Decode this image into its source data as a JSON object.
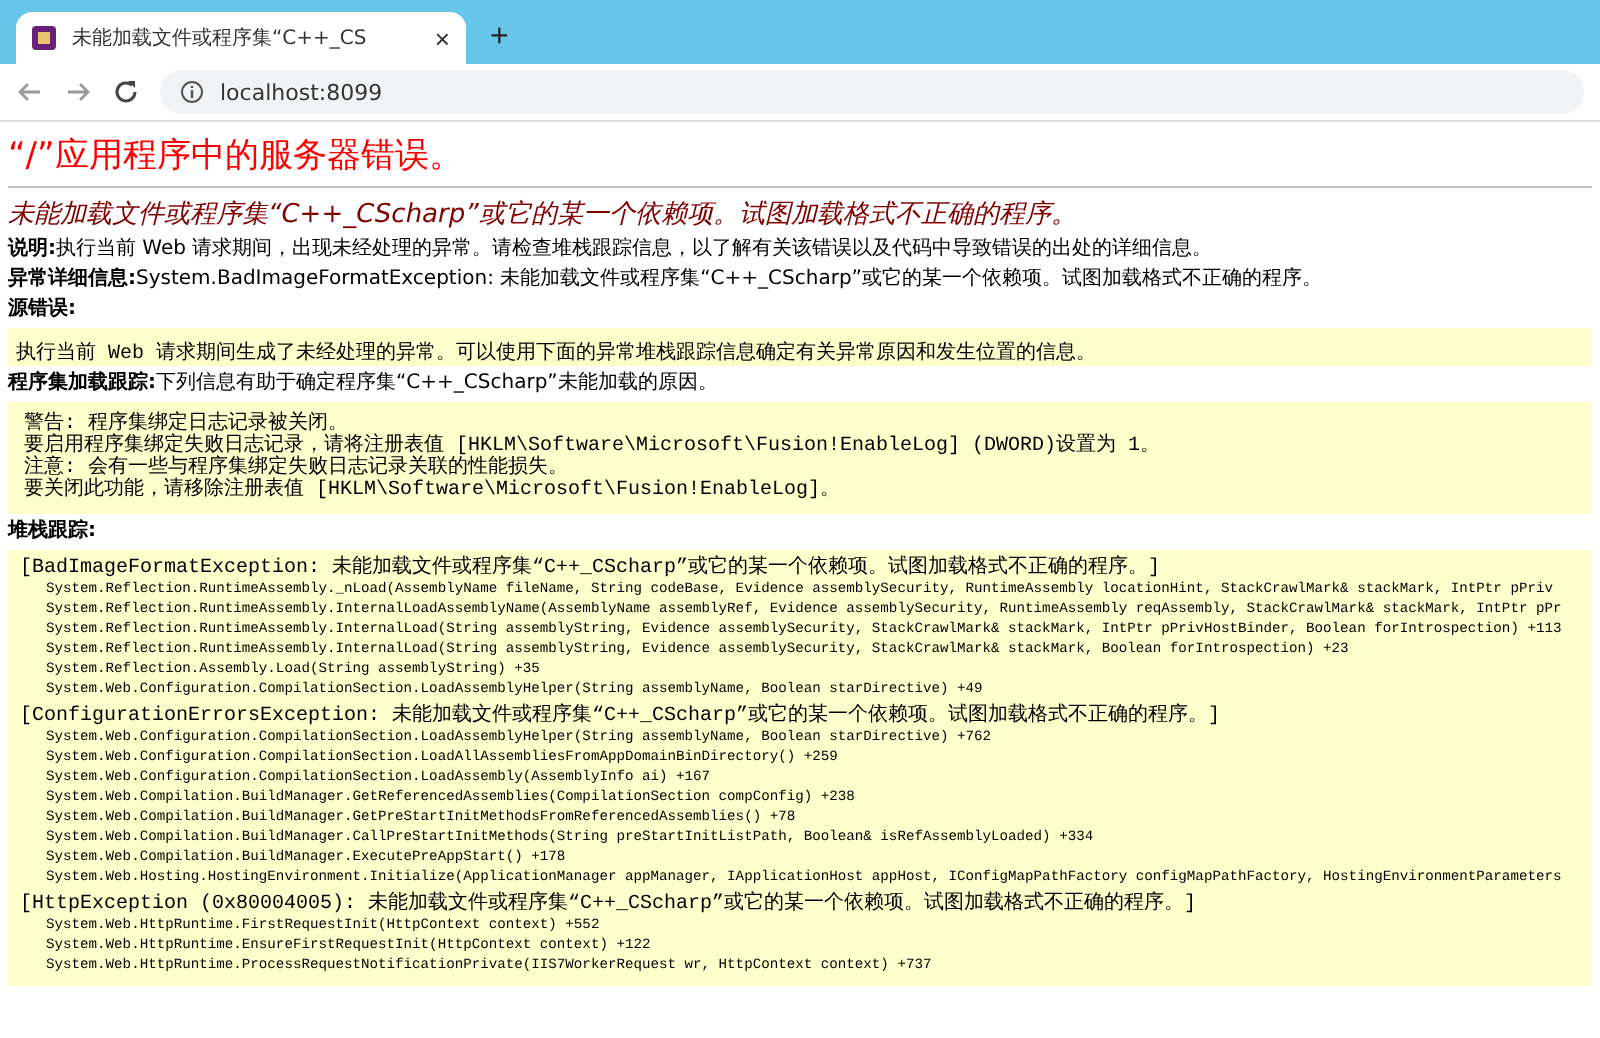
{
  "browser": {
    "tab_title": "未能加载文件或程序集“C++_CS",
    "tab_close": "×",
    "new_tab": "+",
    "url": "localhost:8099"
  },
  "page": {
    "heading": "“/”应用程序中的服务器错误。",
    "subheading": "未能加载文件或程序集“C++_CScharp”或它的某一个依赖项。试图加载格式不正确的程序。",
    "description": {
      "label": "说明:",
      "text": "执行当前 Web 请求期间，出现未经处理的异常。请检查堆栈跟踪信息，以了解有关该错误以及代码中导致错误的出处的详细信息。"
    },
    "exception_details": {
      "label": "异常详细信息:",
      "text": "System.BadImageFormatException: 未能加载文件或程序集“C++_CScharp”或它的某一个依赖项。试图加载格式不正确的程序。"
    },
    "source_error": {
      "label": "源错误:",
      "text": "执行当前 Web 请求期间生成了未经处理的异常。可以使用下面的异常堆栈跟踪信息确定有关异常原因和发生位置的信息。"
    },
    "assembly_trace": {
      "label": "程序集加载跟踪:",
      "text": "下列信息有助于确定程序集“C++_CScharp”未能加载的原因。",
      "lines": [
        "警告: 程序集绑定日志记录被关闭。",
        "要启用程序集绑定失败日志记录，请将注册表值 [HKLM\\Software\\Microsoft\\Fusion!EnableLog] (DWORD)设置为 1。",
        "注意: 会有一些与程序集绑定失败日志记录关联的性能损失。",
        "要关闭此功能，请移除注册表值 [HKLM\\Software\\Microsoft\\Fusion!EnableLog]。"
      ]
    },
    "stack_trace": {
      "label": "堆栈跟踪:",
      "blocks": [
        {
          "header": "[BadImageFormatException: 未能加载文件或程序集“C++_CScharp”或它的某一个依赖项。试图加载格式不正确的程序。]",
          "lines": [
            "System.Reflection.RuntimeAssembly._nLoad(AssemblyName fileName, String codeBase, Evidence assemblySecurity, RuntimeAssembly locationHint, StackCrawlMark& stackMark, IntPtr pPriv",
            "System.Reflection.RuntimeAssembly.InternalLoadAssemblyName(AssemblyName assemblyRef, Evidence assemblySecurity, RuntimeAssembly reqAssembly, StackCrawlMark& stackMark, IntPtr pPr",
            "System.Reflection.RuntimeAssembly.InternalLoad(String assemblyString, Evidence assemblySecurity, StackCrawlMark& stackMark, IntPtr pPrivHostBinder, Boolean forIntrospection) +113",
            "System.Reflection.RuntimeAssembly.InternalLoad(String assemblyString, Evidence assemblySecurity, StackCrawlMark& stackMark, Boolean forIntrospection) +23",
            "System.Reflection.Assembly.Load(String assemblyString) +35",
            "System.Web.Configuration.CompilationSection.LoadAssemblyHelper(String assemblyName, Boolean starDirective) +49"
          ]
        },
        {
          "header": "[ConfigurationErrorsException: 未能加载文件或程序集“C++_CScharp”或它的某一个依赖项。试图加载格式不正确的程序。]",
          "lines": [
            "System.Web.Configuration.CompilationSection.LoadAssemblyHelper(String assemblyName, Boolean starDirective) +762",
            "System.Web.Configuration.CompilationSection.LoadAllAssembliesFromAppDomainBinDirectory() +259",
            "System.Web.Configuration.CompilationSection.LoadAssembly(AssemblyInfo ai) +167",
            "System.Web.Compilation.BuildManager.GetReferencedAssemblies(CompilationSection compConfig) +238",
            "System.Web.Compilation.BuildManager.GetPreStartInitMethodsFromReferencedAssemblies() +78",
            "System.Web.Compilation.BuildManager.CallPreStartInitMethods(String preStartInitListPath, Boolean& isRefAssemblyLoaded) +334",
            "System.Web.Compilation.BuildManager.ExecutePreAppStart() +178",
            "System.Web.Hosting.HostingEnvironment.Initialize(ApplicationManager appManager, IApplicationHost appHost, IConfigMapPathFactory configMapPathFactory, HostingEnvironmentParameters"
          ]
        },
        {
          "header": "[HttpException (0x80004005): 未能加载文件或程序集“C++_CScharp”或它的某一个依赖项。试图加载格式不正确的程序。]",
          "lines": [
            "System.Web.HttpRuntime.FirstRequestInit(HttpContext context) +552",
            "System.Web.HttpRuntime.EnsureFirstRequestInit(HttpContext context) +122",
            "System.Web.HttpRuntime.ProcessRequestNotificationPrivate(IIS7WorkerRequest wr, HttpContext context) +737"
          ]
        }
      ]
    }
  }
}
